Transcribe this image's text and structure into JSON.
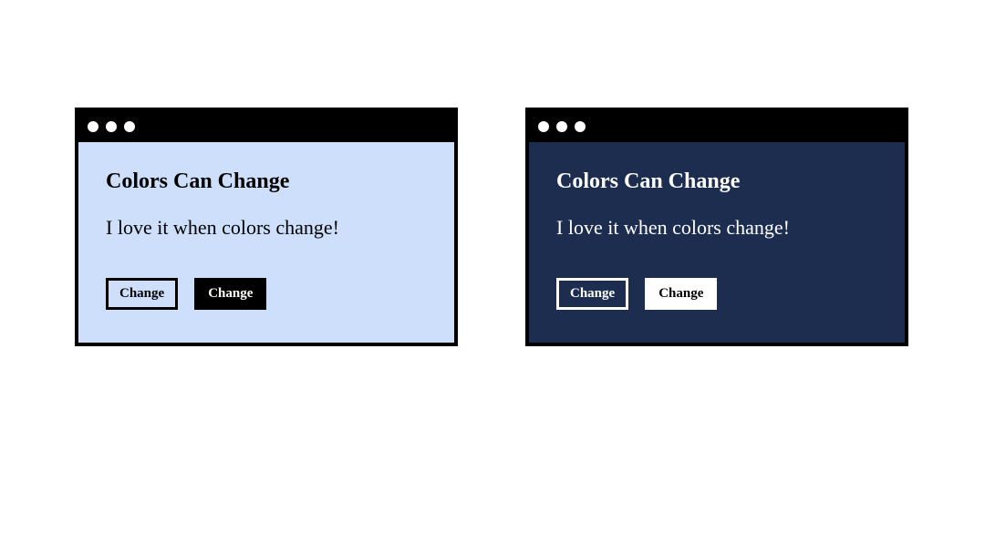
{
  "diagram": {
    "description": "Two side-by-side browser-window mockups demonstrating light vs dark color themes",
    "colors": {
      "light_bg": "#cddffb",
      "dark_bg": "#1d2d4f",
      "chrome": "#000000",
      "dot": "#ffffff"
    },
    "windows": [
      {
        "id": "light",
        "heading": "Colors Can Change",
        "body": "I love it when colors change!",
        "buttons": [
          {
            "label": "Change",
            "style": "outline"
          },
          {
            "label": "Change",
            "style": "solid"
          }
        ]
      },
      {
        "id": "dark",
        "heading": "Colors Can Change",
        "body": "I love it when colors change!",
        "buttons": [
          {
            "label": "Change",
            "style": "outline"
          },
          {
            "label": "Change",
            "style": "solid"
          }
        ]
      }
    ]
  }
}
